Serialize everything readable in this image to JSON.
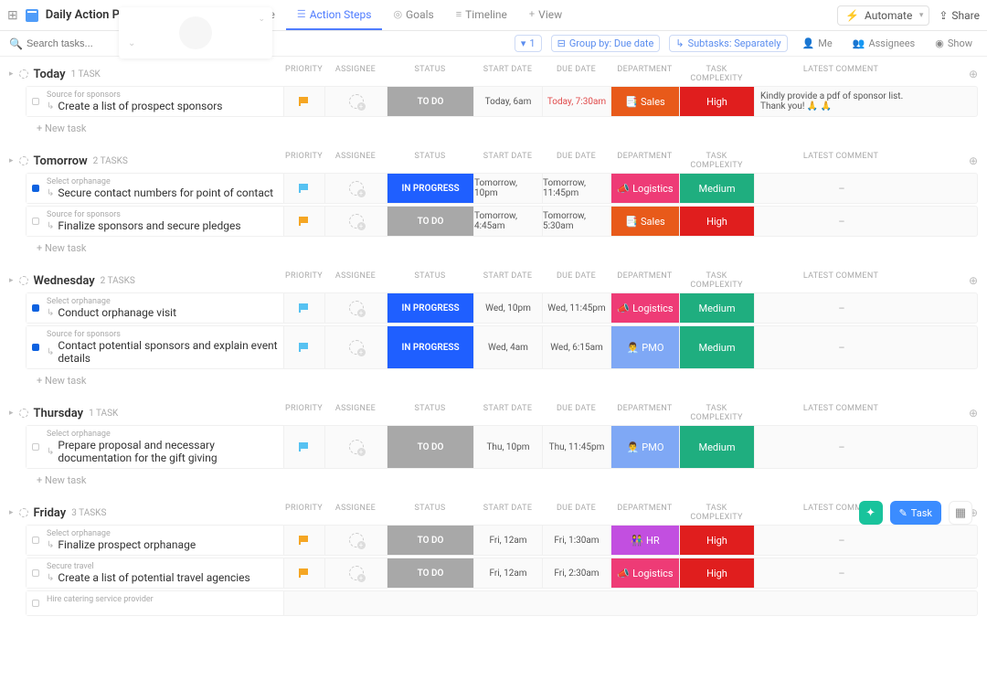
{
  "header": {
    "title": "Daily Action Plan",
    "tabs": [
      {
        "label": "Getting Started Guide",
        "icon": "doc"
      },
      {
        "label": "Action Steps",
        "icon": "list",
        "active": true
      },
      {
        "label": "Goals",
        "icon": "target"
      },
      {
        "label": "Timeline",
        "icon": "timeline"
      },
      {
        "label": "View",
        "icon": "plus"
      }
    ],
    "automate": "Automate",
    "share": "Share"
  },
  "filter": {
    "search_placeholder": "Search tasks...",
    "filter_count": "1",
    "group_by": "Group by: Due date",
    "subtasks": "Subtasks: Separately",
    "me": "Me",
    "assignees": "Assignees",
    "show": "Show"
  },
  "cols": {
    "priority": "PRIORITY",
    "assignee": "ASSIGNEE",
    "status": "STATUS",
    "start": "START DATE",
    "due": "DUE DATE",
    "dept": "DEPARTMENT",
    "complex": "TASK COMPLEXITY",
    "comment": "LATEST COMMENT"
  },
  "statuses": {
    "todo": "TO DO",
    "progress": "IN PROGRESS"
  },
  "depts": {
    "sales": "Sales",
    "log": "Logistics",
    "pmo": "PMO",
    "hr": "HR"
  },
  "dept_icons": {
    "sales": "📑",
    "log": "📣",
    "pmo": "👨‍💼",
    "hr": "👫"
  },
  "complexities": {
    "high": "High",
    "med": "Medium"
  },
  "new_task": "+ New task",
  "groups": [
    {
      "name": "Today",
      "count": "1 TASK",
      "tasks": [
        {
          "parent": "Source for sponsors",
          "name": "Create a list of prospect sponsors",
          "flag": "orange",
          "status": "todo",
          "start": "Today, 6am",
          "due": "Today, 7:30am",
          "due_over": true,
          "dept": "sales",
          "complex": "high",
          "comment": "Kindly provide a pdf of sponsor list. Thank you! 🙏 🙏",
          "checked": false
        }
      ]
    },
    {
      "name": "Tomorrow",
      "count": "2 TASKS",
      "tasks": [
        {
          "parent": "Select orphanage",
          "name": "Secure contact numbers for point of contact",
          "flag": "blue",
          "status": "progress",
          "start": "Tomorrow, 10pm",
          "due": "Tomorrow, 11:45pm",
          "dept": "log",
          "complex": "med",
          "comment": "–",
          "checked": true
        },
        {
          "parent": "Source for sponsors",
          "name": "Finalize sponsors and secure pledges",
          "flag": "orange",
          "status": "todo",
          "start": "Tomorrow, 4:45am",
          "due": "Tomorrow, 5:30am",
          "dept": "sales",
          "complex": "high",
          "comment": "–",
          "checked": false
        }
      ]
    },
    {
      "name": "Wednesday",
      "count": "2 TASKS",
      "tasks": [
        {
          "parent": "Select orphanage",
          "name": "Conduct orphanage visit",
          "flag": "blue",
          "status": "progress",
          "start": "Wed, 10pm",
          "due": "Wed, 11:45pm",
          "dept": "log",
          "complex": "med",
          "comment": "–",
          "checked": true
        },
        {
          "parent": "Source for sponsors",
          "name": "Contact potential sponsors and explain event details",
          "flag": "blue",
          "status": "progress",
          "start": "Wed, 4am",
          "due": "Wed, 6:15am",
          "dept": "pmo",
          "complex": "med",
          "comment": "–",
          "checked": true
        }
      ]
    },
    {
      "name": "Thursday",
      "count": "1 TASK",
      "tasks": [
        {
          "parent": "Select orphanage",
          "name": "Prepare proposal and necessary documentation for the gift giving",
          "flag": "blue",
          "status": "todo",
          "start": "Thu, 10pm",
          "due": "Thu, 11:45pm",
          "dept": "pmo",
          "complex": "med",
          "comment": "–",
          "checked": false
        }
      ]
    },
    {
      "name": "Friday",
      "count": "3 TASKS",
      "tasks": [
        {
          "parent": "Select orphanage",
          "name": "Finalize prospect orphanage",
          "flag": "orange",
          "status": "todo",
          "start": "Fri, 12am",
          "due": "Fri, 1:30am",
          "dept": "hr",
          "complex": "high",
          "comment": "–",
          "checked": false
        },
        {
          "parent": "Secure travel",
          "name": "Create a list of potential travel agencies",
          "flag": "orange",
          "status": "todo",
          "start": "Fri, 12am",
          "due": "Fri, 2:30am",
          "dept": "log",
          "complex": "high",
          "comment": "–",
          "checked": false
        },
        {
          "parent": "Hire catering service provider",
          "name": "",
          "flag": "",
          "status": "",
          "start": "",
          "due": "",
          "dept": "",
          "complex": "",
          "comment": "",
          "checked": false,
          "stub": true
        }
      ]
    }
  ],
  "floater": {
    "task": "Task"
  }
}
